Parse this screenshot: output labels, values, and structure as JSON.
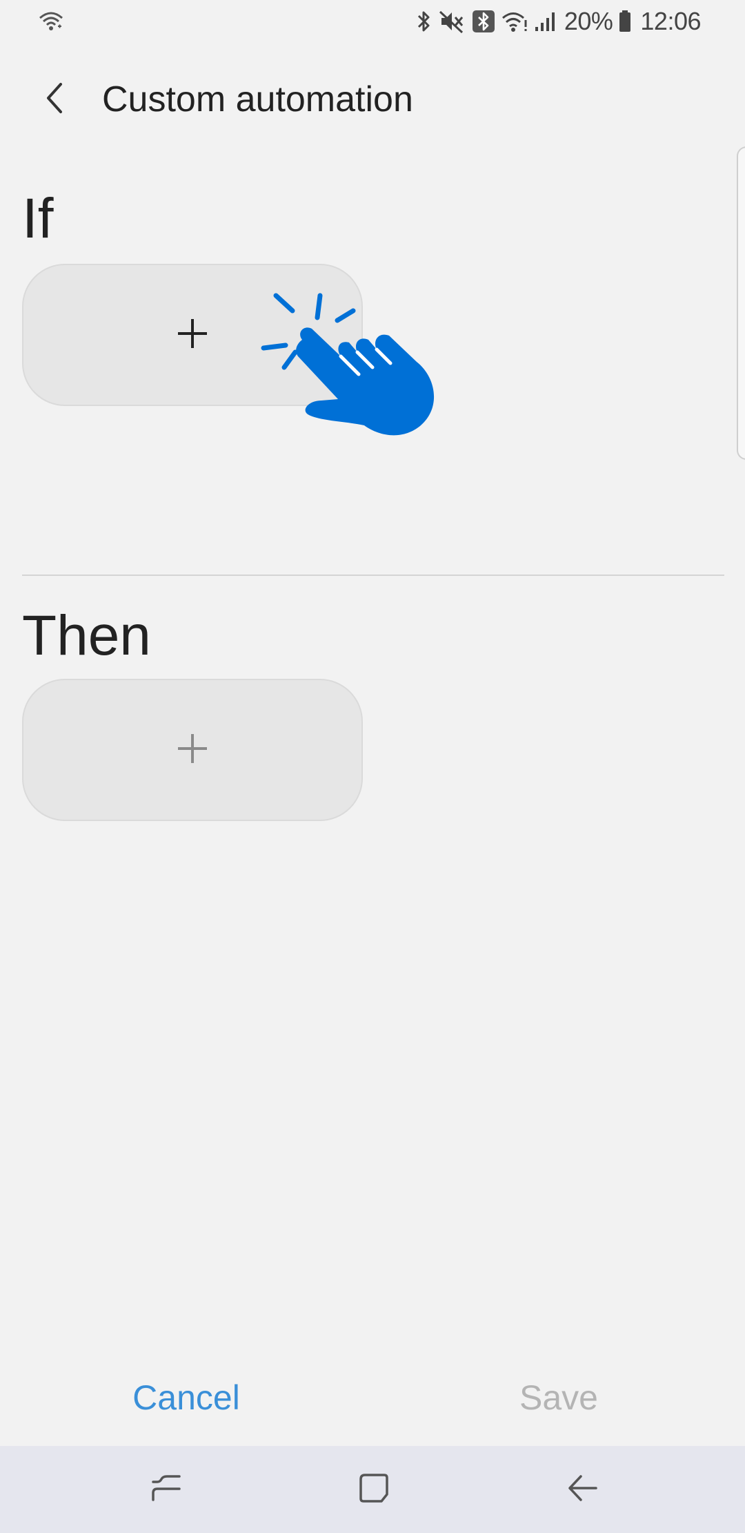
{
  "status_bar": {
    "battery_percent": "20%",
    "time": "12:06",
    "icons": [
      "wifi-calling-icon",
      "bluetooth-icon",
      "mute-icon",
      "bluetooth-badge-icon",
      "wifi-icon",
      "signal-icon",
      "battery-icon"
    ]
  },
  "header": {
    "title": "Custom automation",
    "back_icon": "chevron-left-icon"
  },
  "if_section": {
    "heading": "If",
    "add_icon": "plus-icon"
  },
  "then_section": {
    "heading": "Then",
    "add_icon": "plus-icon"
  },
  "overlay": {
    "icon": "tap-hand-icon",
    "color": "#0070d6"
  },
  "actions": {
    "cancel_label": "Cancel",
    "save_label": "Save",
    "cancel_color": "#3a8fd8",
    "save_color": "#b4b4b4"
  },
  "navigation": {
    "recents_icon": "recents-icon",
    "home_icon": "home-icon",
    "back_icon": "back-arrow-icon"
  }
}
